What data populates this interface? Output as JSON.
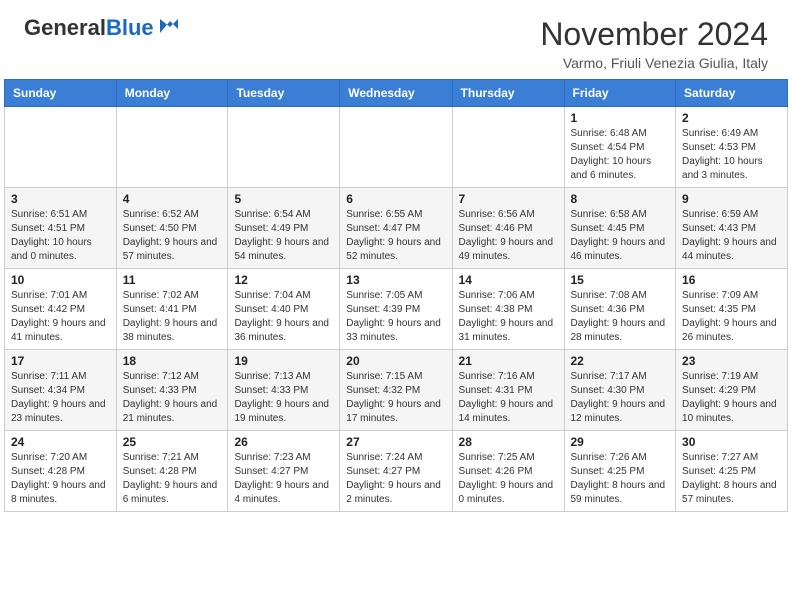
{
  "header": {
    "logo_general": "General",
    "logo_blue": "Blue",
    "month_title": "November 2024",
    "location": "Varmo, Friuli Venezia Giulia, Italy"
  },
  "days_of_week": [
    "Sunday",
    "Monday",
    "Tuesday",
    "Wednesday",
    "Thursday",
    "Friday",
    "Saturday"
  ],
  "weeks": [
    [
      {
        "day": "",
        "info": ""
      },
      {
        "day": "",
        "info": ""
      },
      {
        "day": "",
        "info": ""
      },
      {
        "day": "",
        "info": ""
      },
      {
        "day": "",
        "info": ""
      },
      {
        "day": "1",
        "info": "Sunrise: 6:48 AM\nSunset: 4:54 PM\nDaylight: 10 hours and 6 minutes."
      },
      {
        "day": "2",
        "info": "Sunrise: 6:49 AM\nSunset: 4:53 PM\nDaylight: 10 hours and 3 minutes."
      }
    ],
    [
      {
        "day": "3",
        "info": "Sunrise: 6:51 AM\nSunset: 4:51 PM\nDaylight: 10 hours and 0 minutes."
      },
      {
        "day": "4",
        "info": "Sunrise: 6:52 AM\nSunset: 4:50 PM\nDaylight: 9 hours and 57 minutes."
      },
      {
        "day": "5",
        "info": "Sunrise: 6:54 AM\nSunset: 4:49 PM\nDaylight: 9 hours and 54 minutes."
      },
      {
        "day": "6",
        "info": "Sunrise: 6:55 AM\nSunset: 4:47 PM\nDaylight: 9 hours and 52 minutes."
      },
      {
        "day": "7",
        "info": "Sunrise: 6:56 AM\nSunset: 4:46 PM\nDaylight: 9 hours and 49 minutes."
      },
      {
        "day": "8",
        "info": "Sunrise: 6:58 AM\nSunset: 4:45 PM\nDaylight: 9 hours and 46 minutes."
      },
      {
        "day": "9",
        "info": "Sunrise: 6:59 AM\nSunset: 4:43 PM\nDaylight: 9 hours and 44 minutes."
      }
    ],
    [
      {
        "day": "10",
        "info": "Sunrise: 7:01 AM\nSunset: 4:42 PM\nDaylight: 9 hours and 41 minutes."
      },
      {
        "day": "11",
        "info": "Sunrise: 7:02 AM\nSunset: 4:41 PM\nDaylight: 9 hours and 38 minutes."
      },
      {
        "day": "12",
        "info": "Sunrise: 7:04 AM\nSunset: 4:40 PM\nDaylight: 9 hours and 36 minutes."
      },
      {
        "day": "13",
        "info": "Sunrise: 7:05 AM\nSunset: 4:39 PM\nDaylight: 9 hours and 33 minutes."
      },
      {
        "day": "14",
        "info": "Sunrise: 7:06 AM\nSunset: 4:38 PM\nDaylight: 9 hours and 31 minutes."
      },
      {
        "day": "15",
        "info": "Sunrise: 7:08 AM\nSunset: 4:36 PM\nDaylight: 9 hours and 28 minutes."
      },
      {
        "day": "16",
        "info": "Sunrise: 7:09 AM\nSunset: 4:35 PM\nDaylight: 9 hours and 26 minutes."
      }
    ],
    [
      {
        "day": "17",
        "info": "Sunrise: 7:11 AM\nSunset: 4:34 PM\nDaylight: 9 hours and 23 minutes."
      },
      {
        "day": "18",
        "info": "Sunrise: 7:12 AM\nSunset: 4:33 PM\nDaylight: 9 hours and 21 minutes."
      },
      {
        "day": "19",
        "info": "Sunrise: 7:13 AM\nSunset: 4:33 PM\nDaylight: 9 hours and 19 minutes."
      },
      {
        "day": "20",
        "info": "Sunrise: 7:15 AM\nSunset: 4:32 PM\nDaylight: 9 hours and 17 minutes."
      },
      {
        "day": "21",
        "info": "Sunrise: 7:16 AM\nSunset: 4:31 PM\nDaylight: 9 hours and 14 minutes."
      },
      {
        "day": "22",
        "info": "Sunrise: 7:17 AM\nSunset: 4:30 PM\nDaylight: 9 hours and 12 minutes."
      },
      {
        "day": "23",
        "info": "Sunrise: 7:19 AM\nSunset: 4:29 PM\nDaylight: 9 hours and 10 minutes."
      }
    ],
    [
      {
        "day": "24",
        "info": "Sunrise: 7:20 AM\nSunset: 4:28 PM\nDaylight: 9 hours and 8 minutes."
      },
      {
        "day": "25",
        "info": "Sunrise: 7:21 AM\nSunset: 4:28 PM\nDaylight: 9 hours and 6 minutes."
      },
      {
        "day": "26",
        "info": "Sunrise: 7:23 AM\nSunset: 4:27 PM\nDaylight: 9 hours and 4 minutes."
      },
      {
        "day": "27",
        "info": "Sunrise: 7:24 AM\nSunset: 4:27 PM\nDaylight: 9 hours and 2 minutes."
      },
      {
        "day": "28",
        "info": "Sunrise: 7:25 AM\nSunset: 4:26 PM\nDaylight: 9 hours and 0 minutes."
      },
      {
        "day": "29",
        "info": "Sunrise: 7:26 AM\nSunset: 4:25 PM\nDaylight: 8 hours and 59 minutes."
      },
      {
        "day": "30",
        "info": "Sunrise: 7:27 AM\nSunset: 4:25 PM\nDaylight: 8 hours and 57 minutes."
      }
    ]
  ]
}
